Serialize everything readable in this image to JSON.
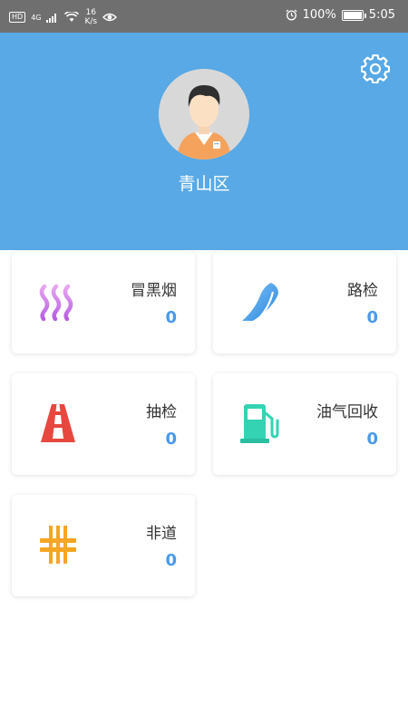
{
  "status_bar": {
    "hd": "HD",
    "network": "4G",
    "speed_value": "16",
    "speed_unit": "K/s",
    "battery_percent": "100%",
    "battery_level": 1.0,
    "time": "5:05"
  },
  "header": {
    "district": "青山区",
    "background": "#58a9e5"
  },
  "cards": [
    {
      "label": "冒黑烟",
      "count": "0",
      "icon": "smoke-icon"
    },
    {
      "label": "路检",
      "count": "0",
      "icon": "road-check-icon"
    },
    {
      "label": "抽检",
      "count": "0",
      "icon": "road-icon"
    },
    {
      "label": "油气回收",
      "count": "0",
      "icon": "fuel-pump-icon"
    },
    {
      "label": "非道",
      "count": "0",
      "icon": "off-road-icon"
    }
  ],
  "colors": {
    "accent": "#4a99e9",
    "smoke": "#c88be6",
    "road_check": "#3d9be9",
    "road": "#e8473f",
    "fuel": "#34d3b3",
    "off_road": "#f5a623"
  }
}
